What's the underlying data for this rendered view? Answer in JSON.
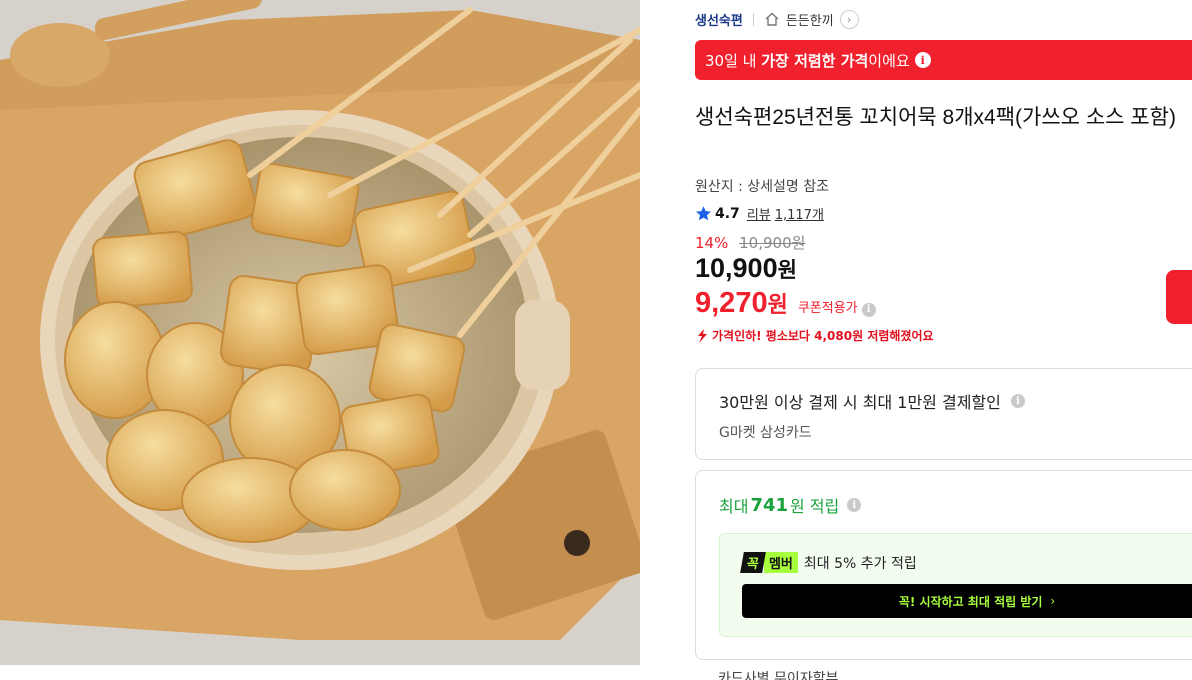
{
  "breadcrumb": {
    "brand": "생선숙편",
    "shop": "든든한끼",
    "icons": {
      "home": "home-icon",
      "arrow": "chevron-right-icon"
    }
  },
  "banner": {
    "prefix": "30일 내 ",
    "bold": "가장 저렴한 가격",
    "suffix": "이에요",
    "color": "#f0202c"
  },
  "product": {
    "title": "생선숙편25년전통 꼬치어묵 8개x4팩(가쓰오 소스 포함)",
    "origin": "원산지 : 상세설명 참조",
    "rating": "4.7",
    "review_label": "리뷰",
    "review_count": "1,117개"
  },
  "price": {
    "discount_rate": "14%",
    "original": "10,900원",
    "sale_value": "10,900",
    "sale_unit": "원",
    "coupon_value": "9,270",
    "coupon_unit": "원",
    "coupon_label": "쿠폰적용가",
    "drop_text": "가격인하! 평소보다 4,080원 저렴해졌어요"
  },
  "card_promo": {
    "title": "30만원 이상 결제 시 최대 1만원 결제할인",
    "subtitle": "G마켓 삼성카드"
  },
  "reward": {
    "prefix": "최대 ",
    "amount": "741",
    "suffix": "원 적립",
    "badge_a": "꼭",
    "badge_b": "멤버",
    "member_text": "최대 5% 추가 적립",
    "button_label": "꼭! 시작하고 최대 적립 받기",
    "accent": "#a8ff3e",
    "green": "#1aa23a"
  },
  "next_section": "카드사별 무이자할부"
}
